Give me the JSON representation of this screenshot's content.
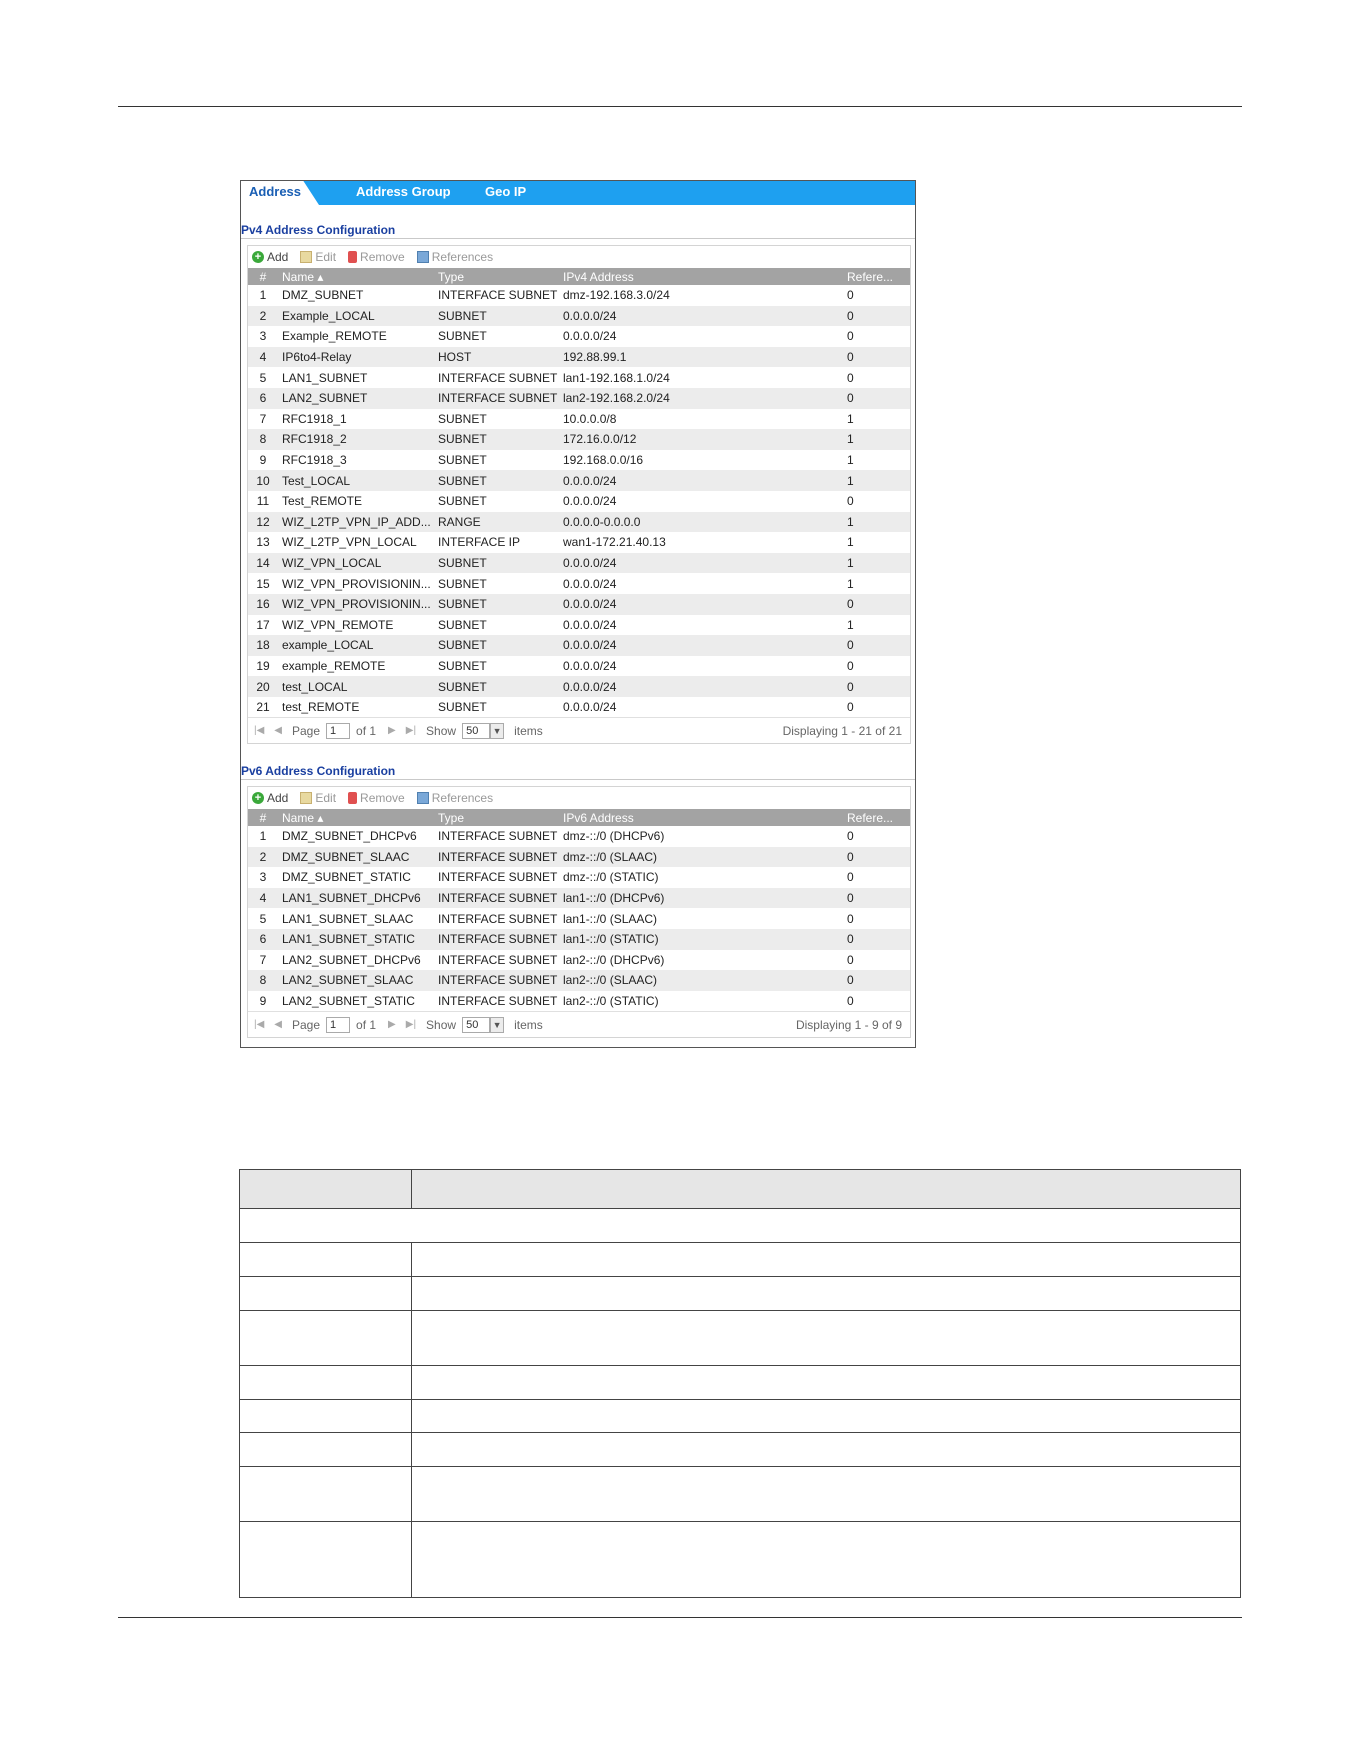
{
  "tabs": [
    {
      "label": "Address",
      "active": true
    },
    {
      "label": "Address Group",
      "active": false
    },
    {
      "label": "Geo IP",
      "active": false
    }
  ],
  "toolbar": {
    "add": "Add",
    "edit": "Edit",
    "remove": "Remove",
    "references": "References"
  },
  "ipv4": {
    "title": "Pv4 Address Configuration",
    "columns": [
      "#",
      "Name ▴",
      "Type",
      "IPv4 Address",
      "Refere..."
    ],
    "rows": [
      [
        "1",
        "DMZ_SUBNET",
        "INTERFACE SUBNET",
        "dmz-192.168.3.0/24",
        "0"
      ],
      [
        "2",
        "Example_LOCAL",
        "SUBNET",
        "0.0.0.0/24",
        "0"
      ],
      [
        "3",
        "Example_REMOTE",
        "SUBNET",
        "0.0.0.0/24",
        "0"
      ],
      [
        "4",
        "IP6to4-Relay",
        "HOST",
        "192.88.99.1",
        "0"
      ],
      [
        "5",
        "LAN1_SUBNET",
        "INTERFACE SUBNET",
        "lan1-192.168.1.0/24",
        "0"
      ],
      [
        "6",
        "LAN2_SUBNET",
        "INTERFACE SUBNET",
        "lan2-192.168.2.0/24",
        "0"
      ],
      [
        "7",
        "RFC1918_1",
        "SUBNET",
        "10.0.0.0/8",
        "1"
      ],
      [
        "8",
        "RFC1918_2",
        "SUBNET",
        "172.16.0.0/12",
        "1"
      ],
      [
        "9",
        "RFC1918_3",
        "SUBNET",
        "192.168.0.0/16",
        "1"
      ],
      [
        "10",
        "Test_LOCAL",
        "SUBNET",
        "0.0.0.0/24",
        "1"
      ],
      [
        "11",
        "Test_REMOTE",
        "SUBNET",
        "0.0.0.0/24",
        "0"
      ],
      [
        "12",
        "WIZ_L2TP_VPN_IP_ADD...",
        "RANGE",
        "0.0.0.0-0.0.0.0",
        "1"
      ],
      [
        "13",
        "WIZ_L2TP_VPN_LOCAL",
        "INTERFACE IP",
        "wan1-172.21.40.13",
        "1"
      ],
      [
        "14",
        "WIZ_VPN_LOCAL",
        "SUBNET",
        "0.0.0.0/24",
        "1"
      ],
      [
        "15",
        "WIZ_VPN_PROVISIONIN...",
        "SUBNET",
        "0.0.0.0/24",
        "1"
      ],
      [
        "16",
        "WIZ_VPN_PROVISIONIN...",
        "SUBNET",
        "0.0.0.0/24",
        "0"
      ],
      [
        "17",
        "WIZ_VPN_REMOTE",
        "SUBNET",
        "0.0.0.0/24",
        "1"
      ],
      [
        "18",
        "example_LOCAL",
        "SUBNET",
        "0.0.0.0/24",
        "0"
      ],
      [
        "19",
        "example_REMOTE",
        "SUBNET",
        "0.0.0.0/24",
        "0"
      ],
      [
        "20",
        "test_LOCAL",
        "SUBNET",
        "0.0.0.0/24",
        "0"
      ],
      [
        "21",
        "test_REMOTE",
        "SUBNET",
        "0.0.0.0/24",
        "0"
      ]
    ],
    "pager": {
      "page_label": "Page",
      "page": "1",
      "of": "of 1",
      "show": "Show",
      "per_page": "50",
      "items": "items",
      "display": "Displaying 1 - 21 of 21"
    }
  },
  "ipv6": {
    "title": "Pv6 Address Configuration",
    "columns": [
      "#",
      "Name ▴",
      "Type",
      "IPv6 Address",
      "Refere..."
    ],
    "rows": [
      [
        "1",
        "DMZ_SUBNET_DHCPv6",
        "INTERFACE SUBNET",
        "dmz-::/0 (DHCPv6)",
        "0"
      ],
      [
        "2",
        "DMZ_SUBNET_SLAAC",
        "INTERFACE SUBNET",
        "dmz-::/0 (SLAAC)",
        "0"
      ],
      [
        "3",
        "DMZ_SUBNET_STATIC",
        "INTERFACE SUBNET",
        "dmz-::/0 (STATIC)",
        "0"
      ],
      [
        "4",
        "LAN1_SUBNET_DHCPv6",
        "INTERFACE SUBNET",
        "lan1-::/0 (DHCPv6)",
        "0"
      ],
      [
        "5",
        "LAN1_SUBNET_SLAAC",
        "INTERFACE SUBNET",
        "lan1-::/0 (SLAAC)",
        "0"
      ],
      [
        "6",
        "LAN1_SUBNET_STATIC",
        "INTERFACE SUBNET",
        "lan1-::/0 (STATIC)",
        "0"
      ],
      [
        "7",
        "LAN2_SUBNET_DHCPv6",
        "INTERFACE SUBNET",
        "lan2-::/0 (DHCPv6)",
        "0"
      ],
      [
        "8",
        "LAN2_SUBNET_SLAAC",
        "INTERFACE SUBNET",
        "lan2-::/0 (SLAAC)",
        "0"
      ],
      [
        "9",
        "LAN2_SUBNET_STATIC",
        "INTERFACE SUBNET",
        "lan2-::/0 (STATIC)",
        "0"
      ]
    ],
    "pager": {
      "page_label": "Page",
      "page": "1",
      "of": "of 1",
      "show": "Show",
      "per_page": "50",
      "items": "items",
      "display": "Displaying 1 - 9 of 9"
    }
  }
}
